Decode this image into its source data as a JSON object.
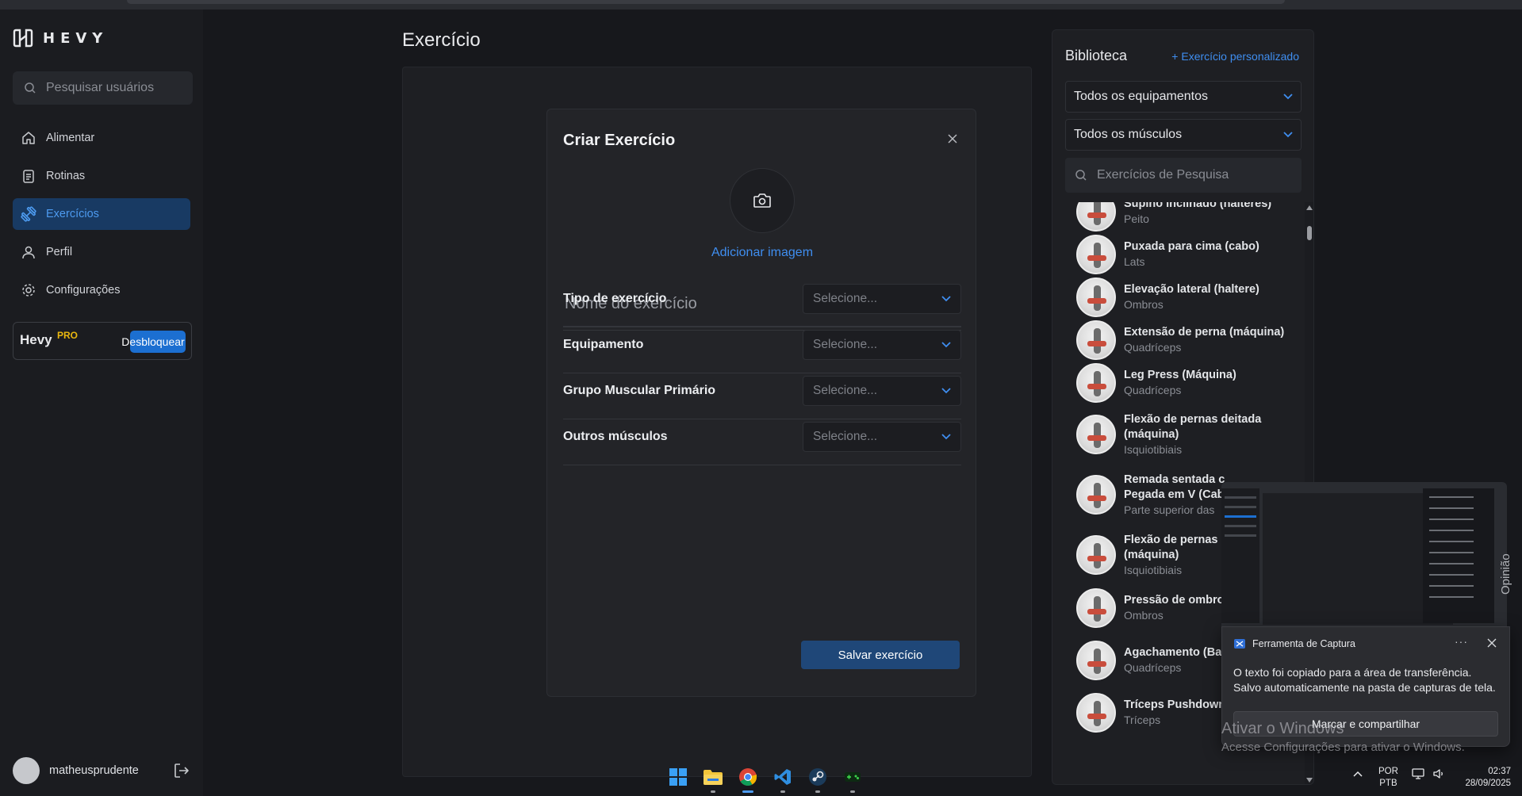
{
  "app": {
    "logo_text": "HEVY"
  },
  "sidebar": {
    "search_placeholder": "Pesquisar usuários",
    "items": [
      {
        "label": "Alimentar"
      },
      {
        "label": "Rotinas"
      },
      {
        "label": "Exercícios"
      },
      {
        "label": "Perfil"
      },
      {
        "label": "Configurações"
      }
    ],
    "pro": {
      "label": "Hevy",
      "sup": "PRO",
      "button": "Desbloquear"
    },
    "user": {
      "name": "matheusprudente"
    }
  },
  "main": {
    "title": "Exercício"
  },
  "modal": {
    "title": "Criar Exercício",
    "add_image": "Adicionar imagem",
    "name_placeholder": "Nome do exercício",
    "rows": [
      {
        "label": "Tipo de exercício",
        "value": "Selecione..."
      },
      {
        "label": "Equipamento",
        "value": "Selecione..."
      },
      {
        "label": "Grupo Muscular Primário",
        "value": "Selecione..."
      },
      {
        "label": "Outros músculos",
        "value": "Selecione..."
      }
    ],
    "save": "Salvar exercício"
  },
  "library": {
    "title": "Biblioteca",
    "custom_link": "+ Exercício personalizado",
    "equipment_filter": "Todos os equipamentos",
    "muscle_filter": "Todos os músculos",
    "search_placeholder": "Exercícios de Pesquisa",
    "exercises": [
      {
        "name": "Supino inclinado (halteres)",
        "muscle": "Peito"
      },
      {
        "name": "Puxada para cima (cabo)",
        "muscle": "Lats"
      },
      {
        "name": "Elevação lateral (haltere)",
        "muscle": "Ombros"
      },
      {
        "name": "Extensão de perna (máquina)",
        "muscle": "Quadríceps"
      },
      {
        "name": "Leg Press (Máquina)",
        "muscle": "Quadríceps"
      },
      {
        "name": "Flexão de pernas deitada",
        "name2": "(máquina)",
        "muscle": "Isquiotibiais"
      },
      {
        "name": "Remada sentada c",
        "name2": "Pegada em V (Cab",
        "muscle": "Parte superior das"
      },
      {
        "name": "Flexão de pernas s",
        "name2": "(máquina)",
        "muscle": "Isquiotibiais"
      },
      {
        "name": "Pressão de ombros",
        "muscle": "Ombros"
      },
      {
        "name": "Agachamento (Bar",
        "muscle": "Quadríceps"
      },
      {
        "name": "Tríceps Pushdown",
        "muscle": "Tríceps"
      }
    ]
  },
  "notification": {
    "app": "Ferramenta de Captura",
    "dots": "···",
    "line1": "O texto foi copiado para a área de transferência.",
    "line2": "Salvo automaticamente na pasta de capturas de tela.",
    "button": "Marcar e compartilhar"
  },
  "watermark": {
    "title": "Ativar o Windows",
    "subtitle": "Acesse Configurações para ativar o Windows."
  },
  "side_text": "Opinião",
  "taskbar": {
    "apps": [
      "windows-start",
      "file-explorer",
      "chrome",
      "vscode",
      "steam",
      "game-app"
    ]
  },
  "tray": {
    "lang1": "POR",
    "lang2": "PTB",
    "time": "02:37",
    "date": "28/09/2025"
  },
  "colors": {
    "accent": "#3f8ef0",
    "active_nav_bg": "#183a63",
    "pro_badge": "#e9b70f",
    "save_button": "#1f4778"
  }
}
